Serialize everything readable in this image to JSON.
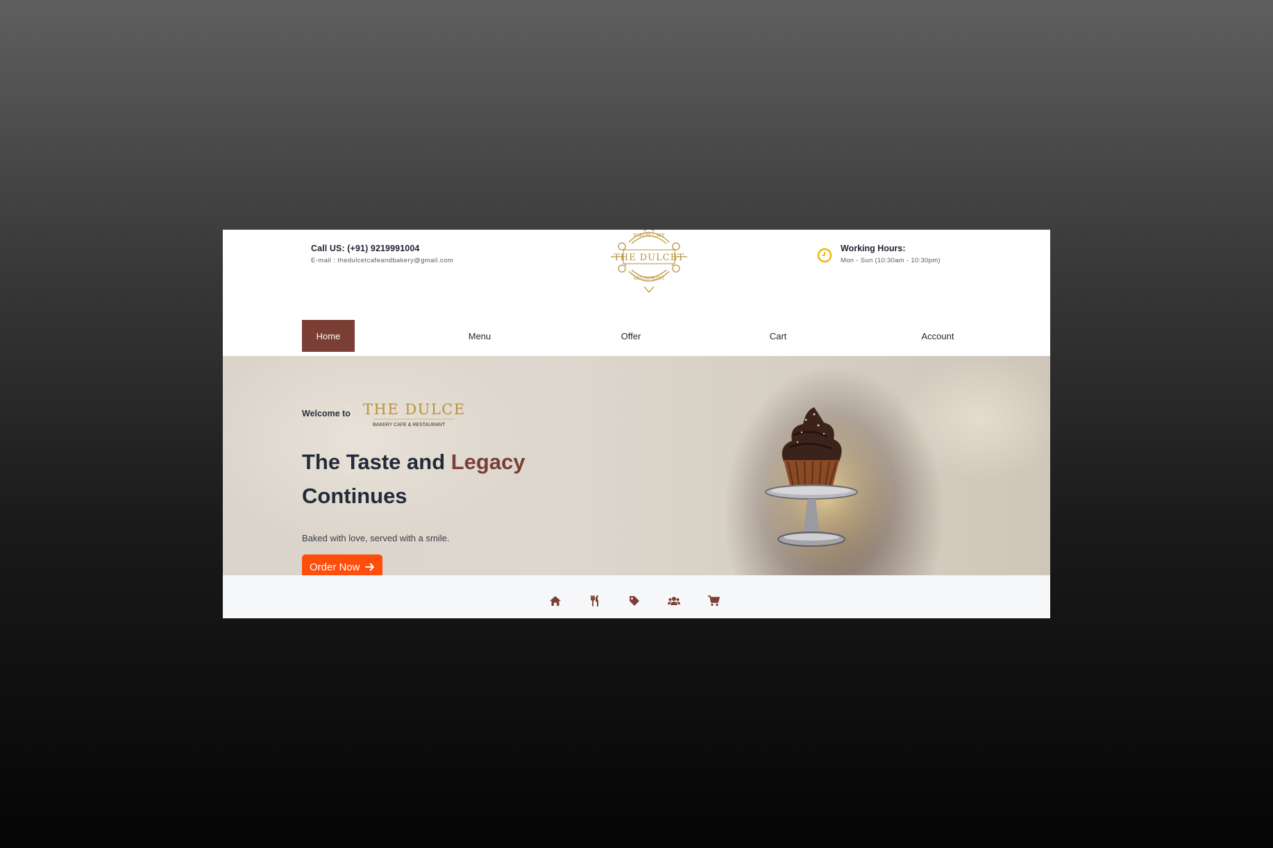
{
  "header": {
    "call": "Call US: (+91) 9219991004",
    "email": "E-mail : thedulcetcafeandbakery@gmail.com",
    "logo_text": {
      "top": "BAKERY CAFE",
      "main": "THE DULCET",
      "bottom": "RESTAURANT"
    },
    "hours_title": "Working Hours:",
    "hours_value": "Mon - Sun (10:30am - 10:30pm)"
  },
  "nav": {
    "items": [
      {
        "label": "Home",
        "active": true
      },
      {
        "label": "Menu",
        "active": false
      },
      {
        "label": "Offer",
        "active": false
      },
      {
        "label": "Cart",
        "active": false
      },
      {
        "label": "Account",
        "active": false
      }
    ]
  },
  "hero": {
    "welcome": "Welcome to",
    "wordmark_main": "THE DULCET",
    "wordmark_sub": "BAKERY CAFE & RESTAURANT",
    "headline_part1": "The Taste and ",
    "headline_accent": "Legacy",
    "headline_part2": "Continues",
    "tagline": "Baked with love, served with a smile.",
    "cta": "Order Now"
  },
  "bottom_icons": [
    "home-icon",
    "utensils-icon",
    "tag-icon",
    "users-icon",
    "cart-icon"
  ],
  "colors": {
    "brand": "#7a3e34",
    "cta": "#ff4d0c",
    "gold": "#b8923a",
    "clock": "#f0b400",
    "text_dark": "#232a3a"
  }
}
